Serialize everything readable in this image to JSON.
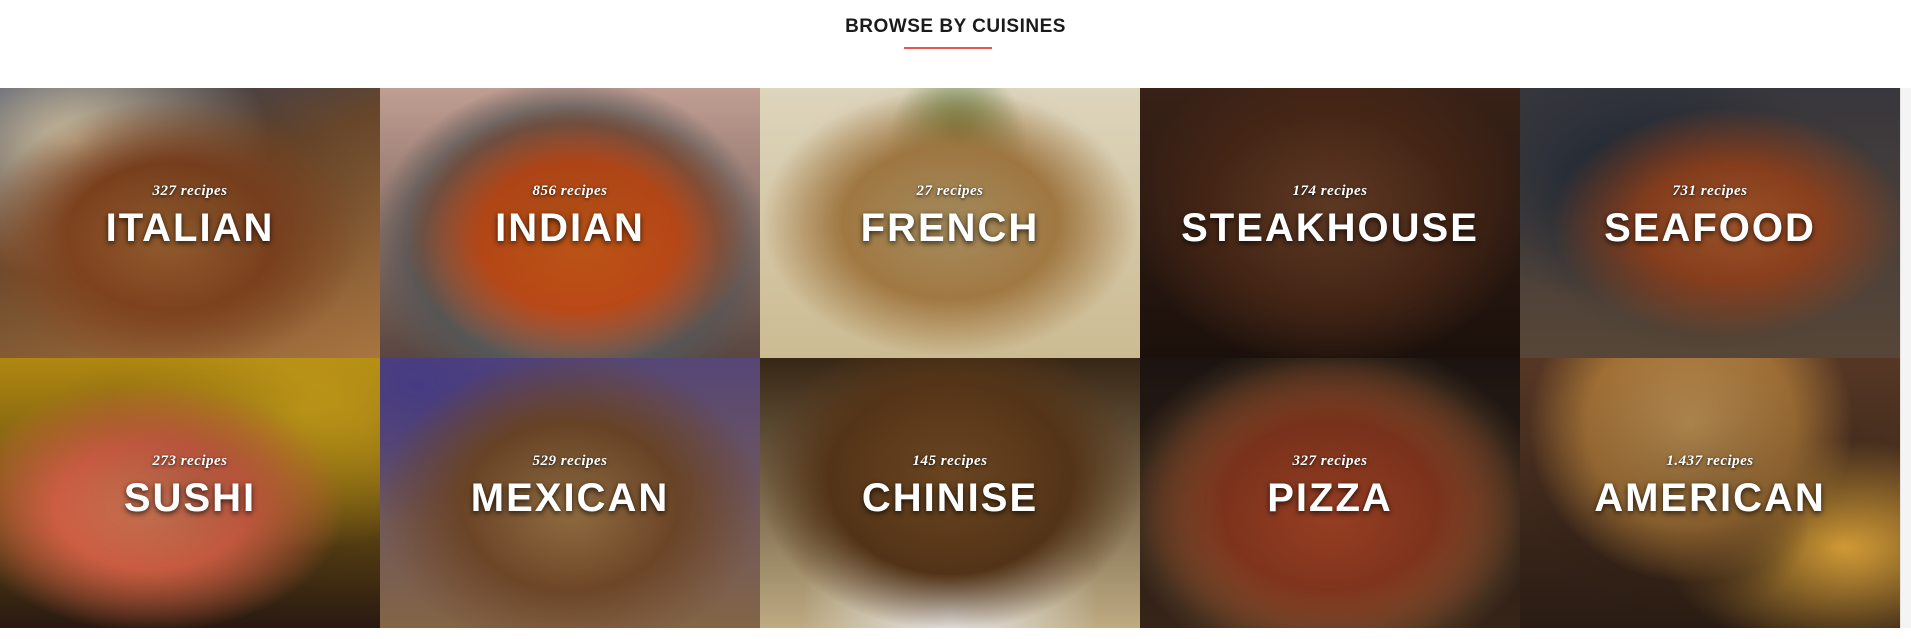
{
  "header": {
    "title": "BROWSE BY CUISINES",
    "underline_color": "#e8554e"
  },
  "cuisines": [
    {
      "name": "ITALIAN",
      "count": "327 recipes",
      "image": "spaghetti-bolognese-photo"
    },
    {
      "name": "INDIAN",
      "count": "856 recipes",
      "image": "curry-bowl-photo"
    },
    {
      "name": "FRENCH",
      "count": "27 recipes",
      "image": "quiche-photo"
    },
    {
      "name": "STEAKHOUSE",
      "count": "174 recipes",
      "image": "grilled-steak-photo"
    },
    {
      "name": "SEAFOOD",
      "count": "731 recipes",
      "image": "paella-seafood-photo"
    },
    {
      "name": "SUSHI",
      "count": "273 recipes",
      "image": "sushi-platter-photo"
    },
    {
      "name": "MEXICAN",
      "count": "529 recipes",
      "image": "nachos-photo"
    },
    {
      "name": "CHINISE",
      "count": "145 recipes",
      "image": "noodle-bowl-photo"
    },
    {
      "name": "PIZZA",
      "count": "327 recipes",
      "image": "pizza-photo"
    },
    {
      "name": "AMERICAN",
      "count": "1.437 recipes",
      "image": "burger-fries-photo"
    }
  ]
}
